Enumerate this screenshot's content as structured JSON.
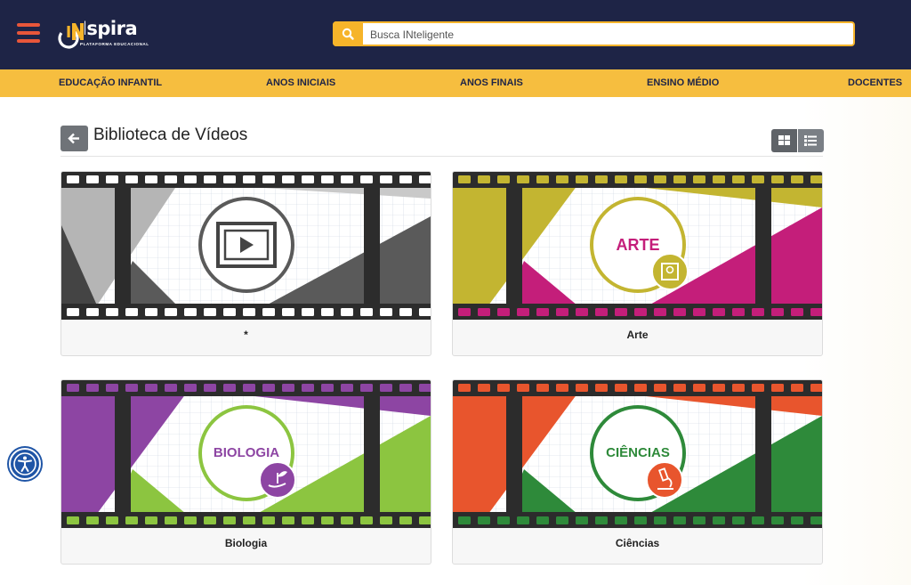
{
  "header": {
    "logo_text": "INspira",
    "logo_subtitle": "PLATAFORMA EDUCACIONAL",
    "search_placeholder": "Busca INteligente",
    "menu_icon": "hamburger-icon",
    "search_icon": "search-icon"
  },
  "nav": {
    "items": [
      {
        "label": "EDUCAÇÃO INFANTIL"
      },
      {
        "label": "ANOS INICIAIS"
      },
      {
        "label": "ANOS FINAIS"
      },
      {
        "label": "ENSINO MÉDIO"
      },
      {
        "label": "DOCENTES"
      }
    ]
  },
  "page": {
    "title": "Biblioteca de Vídeos",
    "back_icon": "arrow-left-icon",
    "view_modes": [
      "grid-view-icon",
      "list-view-icon"
    ],
    "active_view": "grid"
  },
  "cards": [
    {
      "label": "*",
      "badge": "",
      "theme": "gray",
      "icon": "film-play-icon",
      "colors": {
        "primary": "#bdbdbd",
        "dark": "#4a4a4a"
      }
    },
    {
      "label": "Arte",
      "badge": "ARTE",
      "theme": "arte",
      "icon": "art-frame-icon",
      "colors": {
        "primary": "#c3b531",
        "accent": "#c41e7a"
      }
    },
    {
      "label": "Biologia",
      "badge": "BIOLOGIA",
      "theme": "biologia",
      "icon": "plant-hand-icon",
      "colors": {
        "primary": "#8d45a3",
        "accent": "#8cc540"
      }
    },
    {
      "label": "Ciências",
      "badge": "CIÊNCIAS",
      "theme": "ciencias",
      "icon": "microscope-icon",
      "colors": {
        "primary": "#e8552d",
        "accent": "#2e8a3a"
      }
    }
  ],
  "colors": {
    "header_bg": "#1e2446",
    "nav_bg": "#f6be3f",
    "search_accent": "#f6b42a",
    "hamburger": "#e8563a",
    "accessibility": "#1f55a6"
  },
  "accessibility_icon": "accessibility-icon"
}
